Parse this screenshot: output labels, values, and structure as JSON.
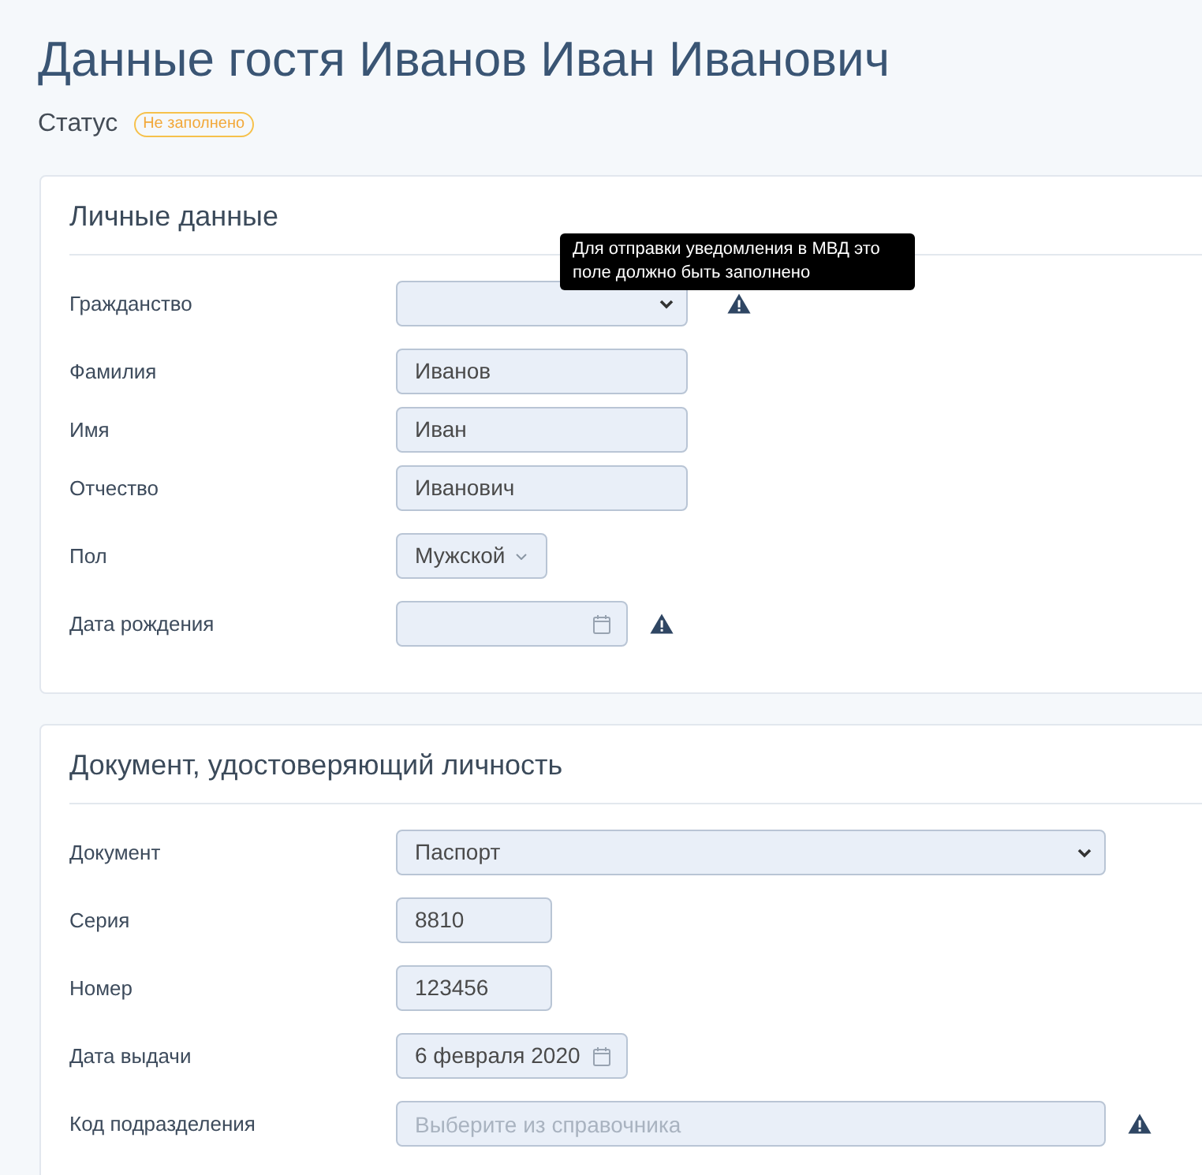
{
  "page": {
    "title": "Данные гостя Иванов Иван Иванович",
    "status_label": "Статус",
    "status_badge": "Не заполнено"
  },
  "sections": [
    {
      "title": "Личные данные",
      "fields": [
        {
          "label": "Гражданство",
          "kind": "select",
          "warning": true,
          "tooltip": "Для отправки уведомления в МВД это поле должно быть заполнено"
        },
        {
          "label": "Фамилия",
          "kind": "text",
          "value": "Иванов",
          "warning": false
        },
        {
          "label": "Имя",
          "kind": "text",
          "value": "Иван",
          "warning": false
        },
        {
          "label": "Отчество",
          "kind": "text",
          "value": "Иванович",
          "warning": false
        },
        {
          "label": "Пол",
          "kind": "dropdown",
          "value": "Мужской",
          "warning": false
        },
        {
          "label": "Дата рождения",
          "kind": "date",
          "warning": true
        }
      ]
    },
    {
      "title": "Документ, удостоверяющий личность",
      "fields": [
        {
          "label": "Документ",
          "kind": "select",
          "value": "Паспорт",
          "warning": false
        },
        {
          "label": "Серия",
          "kind": "text",
          "value": "8810",
          "warning": false
        },
        {
          "label": "Номер",
          "kind": "text",
          "value": "123456",
          "warning": false
        },
        {
          "label": "Дата выдачи",
          "kind": "date",
          "value": "6 февраля 2020",
          "warning": false
        },
        {
          "label": "Код подразделения",
          "kind": "lookup",
          "placeholder": "Выберите из справочника",
          "warning": true
        }
      ]
    }
  ]
}
